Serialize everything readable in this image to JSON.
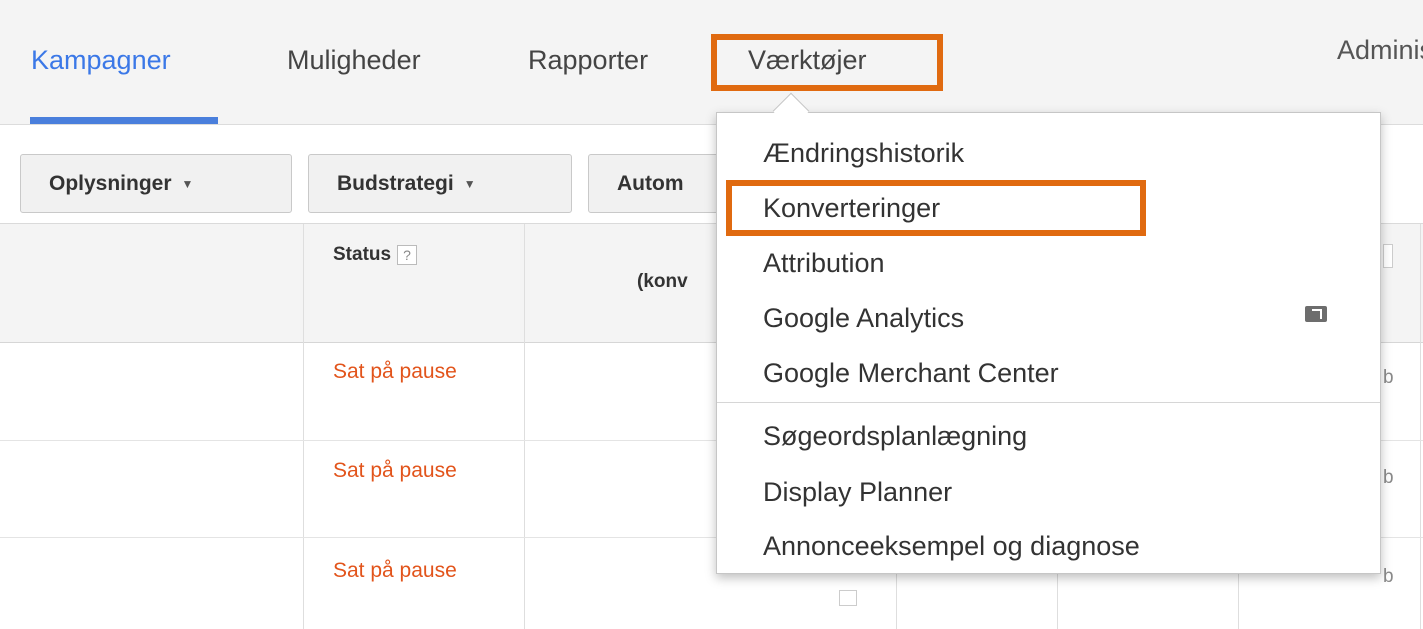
{
  "nav": {
    "tabs": [
      {
        "label": "Kampagner"
      },
      {
        "label": "Muligheder"
      },
      {
        "label": "Rapporter"
      },
      {
        "label": "Værktøjer"
      }
    ],
    "admin_label": "Administ"
  },
  "toolbar": {
    "buttons": [
      {
        "label": "Oplysninger"
      },
      {
        "label": "Budstrategi"
      },
      {
        "label": "Autom"
      }
    ]
  },
  "table": {
    "status_header": "Status",
    "help_glyph": "?",
    "conv_header_fragment": "(konv",
    "rows": [
      {
        "status": "Sat på pause",
        "trail": "b"
      },
      {
        "status": "Sat på pause",
        "trail": "b"
      },
      {
        "status": "Sat på pause",
        "trail": "b"
      }
    ]
  },
  "dropdown": {
    "items": [
      {
        "label": "Ændringshistorik"
      },
      {
        "label": "Konverteringer"
      },
      {
        "label": "Attribution"
      },
      {
        "label": "Google Analytics",
        "icon": "external-link-icon"
      },
      {
        "label": "Google Merchant Center"
      },
      {
        "label": "Søgeordsplanlægning"
      },
      {
        "label": "Display Planner"
      },
      {
        "label": "Annonceeksempel og diagnose"
      }
    ]
  },
  "colors": {
    "highlight": "#e06a10",
    "active_tab": "#3b78e7",
    "paused_status": "#e2541b"
  }
}
